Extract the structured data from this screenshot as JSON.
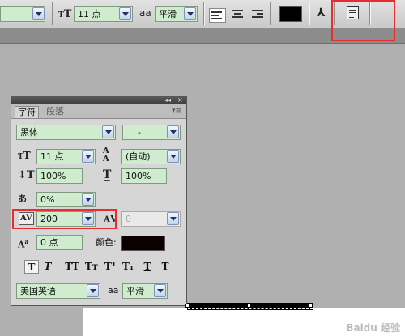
{
  "options_bar": {
    "font_size": {
      "icon": "font-size-icon",
      "value": "11 点"
    },
    "anti_alias": {
      "icon_text": "aa",
      "value": "平滑"
    },
    "align_icons": [
      "align-left-icon",
      "align-center-icon",
      "align-right-icon"
    ],
    "text_color": "#000000",
    "warp_icon_text": "⅄",
    "panels_icon": "character-panel-toggle-icon"
  },
  "panel": {
    "tabs": [
      "字符",
      "段落"
    ],
    "titlebar_collapse": "◂◂",
    "titlebar_close": "×",
    "menu_glyph": "▾≡",
    "font_family": "黑体",
    "font_style": "-",
    "font_size": "11 点",
    "leading": "(自动)",
    "vertical_scale": "100%",
    "horizontal_scale": "100%",
    "tsume": "0%",
    "tracking": "200",
    "kerning": "0",
    "baseline_shift": "0 点",
    "color_label": "颜色:",
    "color_value": "#000000",
    "language": "美国英语",
    "anti_alias_label": "aa",
    "anti_alias": "平滑",
    "style_buttons": [
      "T",
      "T",
      "TT",
      "Tт",
      "T¹",
      "T₁",
      "T",
      "Ŧ"
    ]
  },
  "watermark": "Baidu 经验"
}
